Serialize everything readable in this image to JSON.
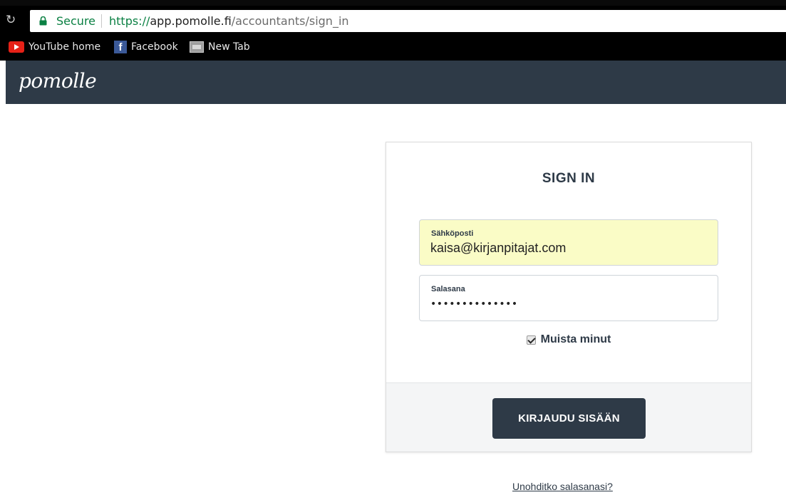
{
  "browser": {
    "secure_label": "Secure",
    "url": {
      "scheme": "https://",
      "host": "app.pomolle.fi",
      "path": "/accountants/sign_in"
    },
    "bookmarks": [
      {
        "label": "YouTube home",
        "icon": "youtube-icon"
      },
      {
        "label": "Facebook",
        "icon": "facebook-icon"
      },
      {
        "label": "New Tab",
        "icon": "new-tab-icon"
      }
    ]
  },
  "app": {
    "logo": "pomolle",
    "header_color": "#2e3a47"
  },
  "signin": {
    "title": "SIGN IN",
    "email": {
      "label": "Sähköposti",
      "value": "kaisa@kirjanpitajat.com",
      "autofill_color": "#fafcc6"
    },
    "password": {
      "label": "Salasana",
      "masked_value": "••••••••••••••"
    },
    "remember": {
      "label": "Muista minut",
      "checked": true
    },
    "submit_label": "KIRJAUDU SISÄÄN",
    "forgot_link": "Unohditko salasanasi?"
  }
}
